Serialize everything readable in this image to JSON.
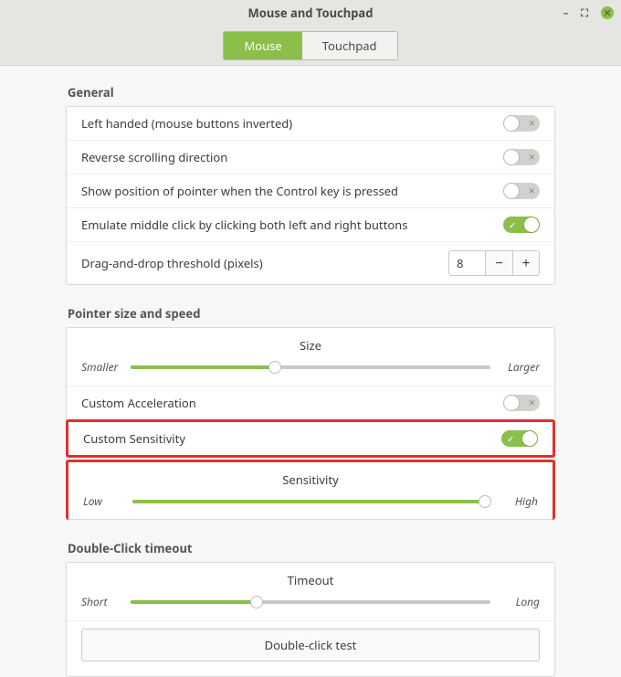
{
  "window": {
    "title": "Mouse and Touchpad"
  },
  "tabs": {
    "mouse": "Mouse",
    "touchpad": "Touchpad"
  },
  "general": {
    "title": "General",
    "left_handed": {
      "label": "Left handed (mouse buttons inverted)",
      "on": false
    },
    "reverse_scroll": {
      "label": "Reverse scrolling direction",
      "on": false
    },
    "show_pointer": {
      "label": "Show position of pointer when the Control key is pressed",
      "on": false
    },
    "emulate_middle": {
      "label": "Emulate middle click by clicking both left and right buttons",
      "on": true
    },
    "drag_threshold": {
      "label": "Drag-and-drop threshold (pixels)",
      "value": "8"
    }
  },
  "pointer": {
    "title": "Pointer size and speed",
    "size_label": "Size",
    "size_min": "Smaller",
    "size_max": "Larger",
    "size_pct": 40,
    "custom_accel": {
      "label": "Custom Acceleration",
      "on": false
    },
    "custom_sens": {
      "label": "Custom Sensitivity",
      "on": true
    },
    "sensitivity_label": "Sensitivity",
    "sens_min": "Low",
    "sens_max": "High",
    "sens_pct": 99
  },
  "doubleclick": {
    "title": "Double-Click timeout",
    "timeout_label": "Timeout",
    "min": "Short",
    "max": "Long",
    "pct": 35,
    "test_label": "Double-click test"
  }
}
